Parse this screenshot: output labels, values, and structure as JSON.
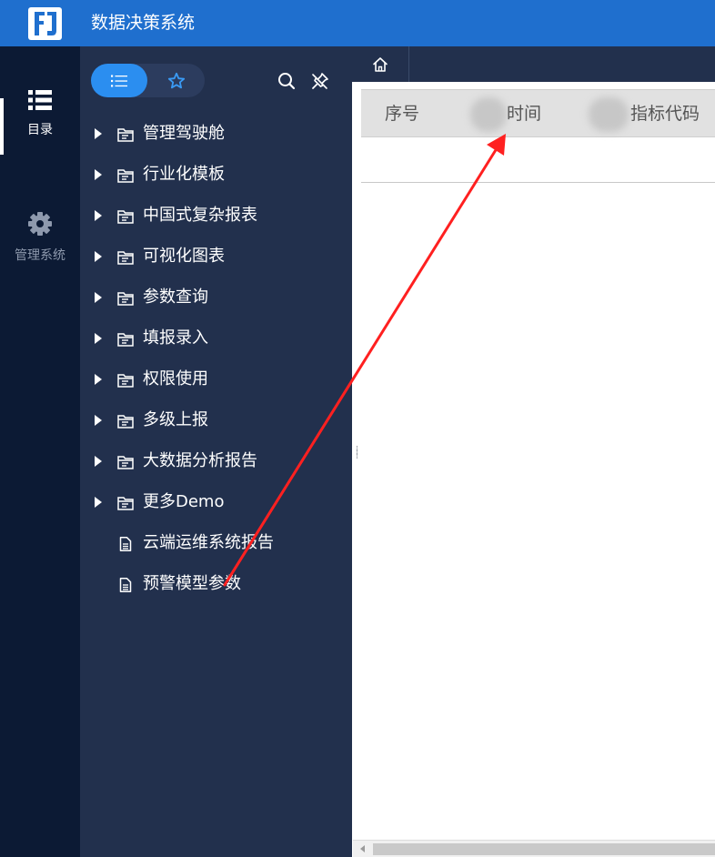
{
  "app": {
    "title": "数据决策系统"
  },
  "rail": {
    "items": [
      {
        "label": "目录",
        "icon": "list-icon",
        "active": true
      },
      {
        "label": "管理系统",
        "icon": "gear-icon",
        "active": false
      }
    ]
  },
  "directory": {
    "segments": [
      {
        "icon": "list-icon",
        "active": true
      },
      {
        "icon": "star-icon",
        "active": false
      }
    ],
    "tools": [
      "search-icon",
      "pin-off-icon"
    ],
    "folders": [
      "管理驾驶舱",
      "行业化模板",
      "中国式复杂报表",
      "可视化图表",
      "参数查询",
      "填报录入",
      "权限使用",
      "多级上报",
      "大数据分析报告",
      "更多Demo"
    ],
    "files": [
      "云端运维系统报告",
      "预警模型参数"
    ]
  },
  "tabs": {
    "home_icon": "home-icon"
  },
  "table": {
    "headers": [
      "序号",
      "时间",
      "指标代码"
    ],
    "rows": []
  },
  "colors": {
    "header_bg": "#1f6fce",
    "rail_bg": "#0c1a34",
    "panel_bg": "#22304d",
    "accent": "#2b8ef0",
    "annotation_arrow": "#ff2020"
  }
}
